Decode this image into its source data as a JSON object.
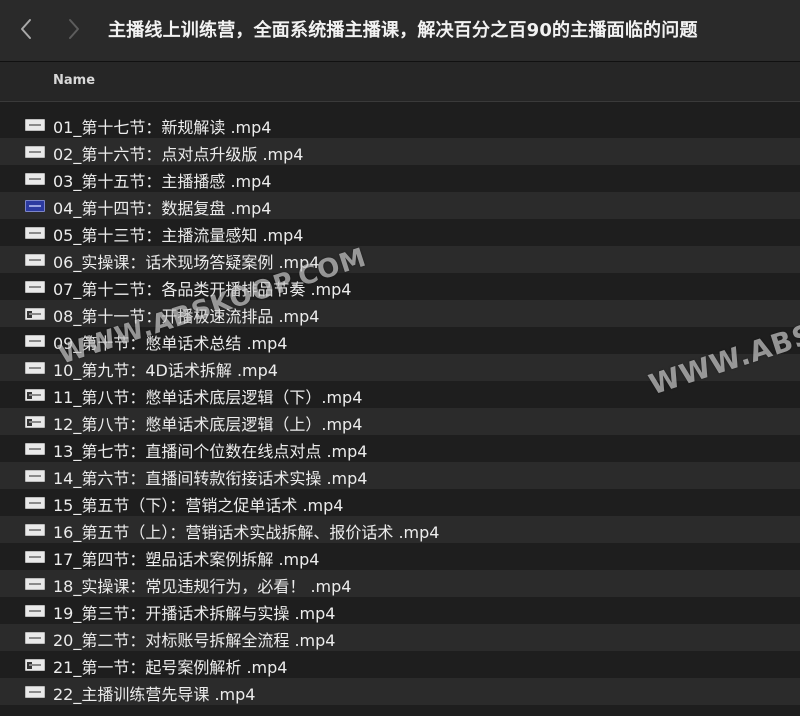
{
  "window": {
    "title": "主播线上训练营，全面系统播主播课，解决百分之百90的主播面临的问题",
    "back_icon": "chevron-left-icon",
    "forward_icon": "chevron-right-icon"
  },
  "list_header": {
    "name_label": "Name"
  },
  "files": [
    {
      "name": "01_第十七节：新规解读 .mp4",
      "icon": "video-file-icon"
    },
    {
      "name": "02_第十六节：点对点升级版 .mp4",
      "icon": "video-file-icon"
    },
    {
      "name": "03_第十五节：主播播感 .mp4",
      "icon": "video-file-icon"
    },
    {
      "name": "04_第十四节：数据复盘 .mp4",
      "icon": "video-file-icon"
    },
    {
      "name": "05_第十三节：主播流量感知 .mp4",
      "icon": "video-file-icon"
    },
    {
      "name": "06_实操课：话术现场答疑案例 .mp4",
      "icon": "video-file-icon"
    },
    {
      "name": "07_第十二节：各品类开播排品节奏 .mp4",
      "icon": "video-file-icon"
    },
    {
      "name": "08_第十一节：开播极速流排品 .mp4",
      "icon": "video-file-icon"
    },
    {
      "name": "09_第十节：憋单话术总结 .mp4",
      "icon": "video-file-icon"
    },
    {
      "name": "10_第九节：4D话术拆解 .mp4",
      "icon": "video-file-icon"
    },
    {
      "name": "11_第八节：憋单话术底层逻辑（下）.mp4",
      "icon": "video-file-icon"
    },
    {
      "name": "12_第八节：憋单话术底层逻辑（上）.mp4",
      "icon": "video-file-icon"
    },
    {
      "name": "13_第七节：直播间个位数在线点对点 .mp4",
      "icon": "video-file-icon"
    },
    {
      "name": "14_第六节：直播间转款衔接话术实操 .mp4",
      "icon": "video-file-icon"
    },
    {
      "name": "15_第五节（下）：营销之促单话术 .mp4",
      "icon": "video-file-icon"
    },
    {
      "name": "16_第五节（上）：营销话术实战拆解、报价话术 .mp4",
      "icon": "video-file-icon"
    },
    {
      "name": "17_第四节：塑品话术案例拆解 .mp4",
      "icon": "video-file-icon"
    },
    {
      "name": "18_实操课：常见违规行为，必看！ .mp4",
      "icon": "video-file-icon"
    },
    {
      "name": "19_第三节：开播话术拆解与实操 .mp4",
      "icon": "video-file-icon"
    },
    {
      "name": "20_第二节：对标账号拆解全流程 .mp4",
      "icon": "video-file-icon"
    },
    {
      "name": "21_第一节：起号案例解析 .mp4",
      "icon": "video-file-icon"
    },
    {
      "name": "22_主播训练营先导课 .mp4",
      "icon": "video-file-icon"
    }
  ],
  "watermarks": [
    "WWW.ABSKOOP.COM",
    "WWW.ABSK"
  ]
}
